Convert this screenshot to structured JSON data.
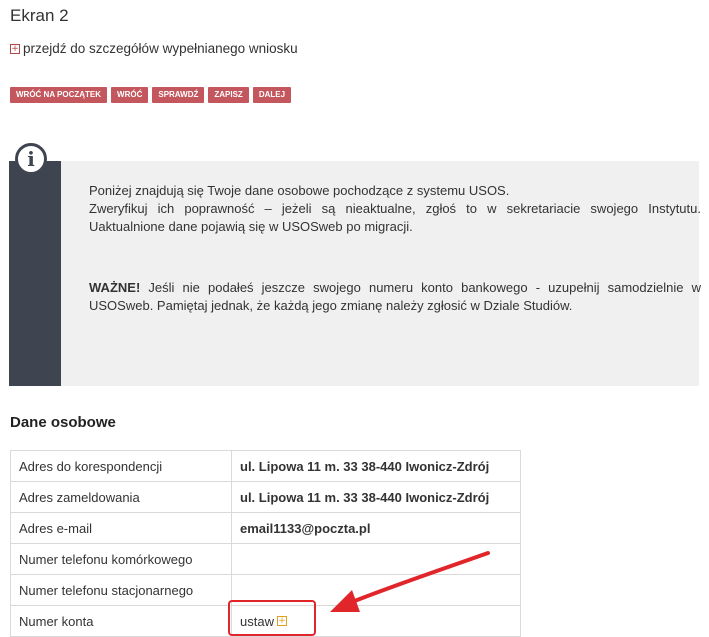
{
  "page": {
    "title": "Ekran 2"
  },
  "detail_link": {
    "label": "przejdź do szczegółów wypełnianego wniosku",
    "icon": "plus-square-icon"
  },
  "buttons": [
    {
      "label": "WRÓĆ NA POCZĄTEK"
    },
    {
      "label": "WRÓĆ"
    },
    {
      "label": "SPRAWDŹ"
    },
    {
      "label": "ZAPISZ"
    },
    {
      "label": "DALEJ"
    }
  ],
  "info": {
    "icon": "info-icon",
    "line1": "Poniżej znajdują się Twoje dane osobowe pochodzące z systemu USOS.",
    "line2": "Zweryfikuj ich poprawność – jeżeli są nieaktualne, zgłoś to w sekretariacie swojego Instytutu. Uaktualnione dane pojawią się w USOSweb po migracji.",
    "warning_label": "WAŻNE!",
    "warning_text": " Jeśli nie podałeś jeszcze swojego numeru konto bankowego - uzupełnij samodzielnie w USOSweb. Pamiętaj jednak, że każdą jego zmianę należy zgłosić w Dziale Studiów."
  },
  "section": {
    "title": "Dane osobowe"
  },
  "table": {
    "rows": [
      {
        "label": "Adres do korespondencji",
        "value": "ul. Lipowa 11 m. 33 38-440 Iwonicz-Zdrój"
      },
      {
        "label": "Adres zameldowania",
        "value": "ul. Lipowa 11 m. 33 38-440 Iwonicz-Zdrój"
      },
      {
        "label": "Adres e-mail",
        "value": "email1133@poczta.pl"
      },
      {
        "label": "Numer telefonu komórkowego",
        "value": ""
      },
      {
        "label": "Numer telefonu stacjonarnego",
        "value": ""
      },
      {
        "label": "Numer konta",
        "value": ""
      }
    ],
    "set_link": {
      "label": "ustaw",
      "icon": "plus-square-icon"
    }
  },
  "colors": {
    "button": "#c4575d",
    "info_bar": "#3f4451",
    "annotation": "#e0262b"
  }
}
